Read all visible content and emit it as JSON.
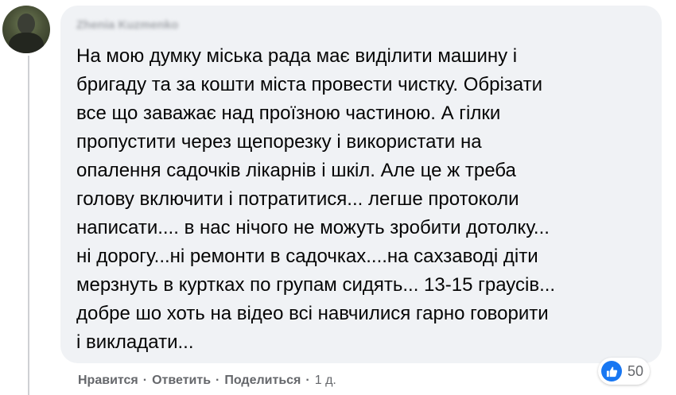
{
  "comment": {
    "author": "Zhenia Kuzmenko",
    "text": "На мою думку міська рада має виділити машину і\nбригаду та за кошти міста провести чистку. Обрізати\nвсе що заважає над проїзною частиною. А гілки\nпропустити через щепорезку і використати на\nопалення садочків лікарнів і шкіл. Але це ж треба\nголову включити і потратитися... легше протоколи\nнаписати.... в нас нічого не можуть зробити дотолку...\nні дорогу...ні ремонти в садочках....на сахзаводі діти\nмерзнуть в куртках по групам сидять... 13-15 граусів...\nдобре шо хоть на відео всі навчилися гарно говорити\nі викладати...",
    "reaction_count": "50",
    "reaction_icon": "like-icon"
  },
  "actions": {
    "like": "Нравится",
    "reply": "Ответить",
    "share": "Поделиться",
    "time": "1 д.",
    "separator": "·"
  },
  "colors": {
    "bubble": "#f0f2f5",
    "text": "#050505",
    "meta": "#65676b",
    "like_blue": "#1877f2"
  }
}
